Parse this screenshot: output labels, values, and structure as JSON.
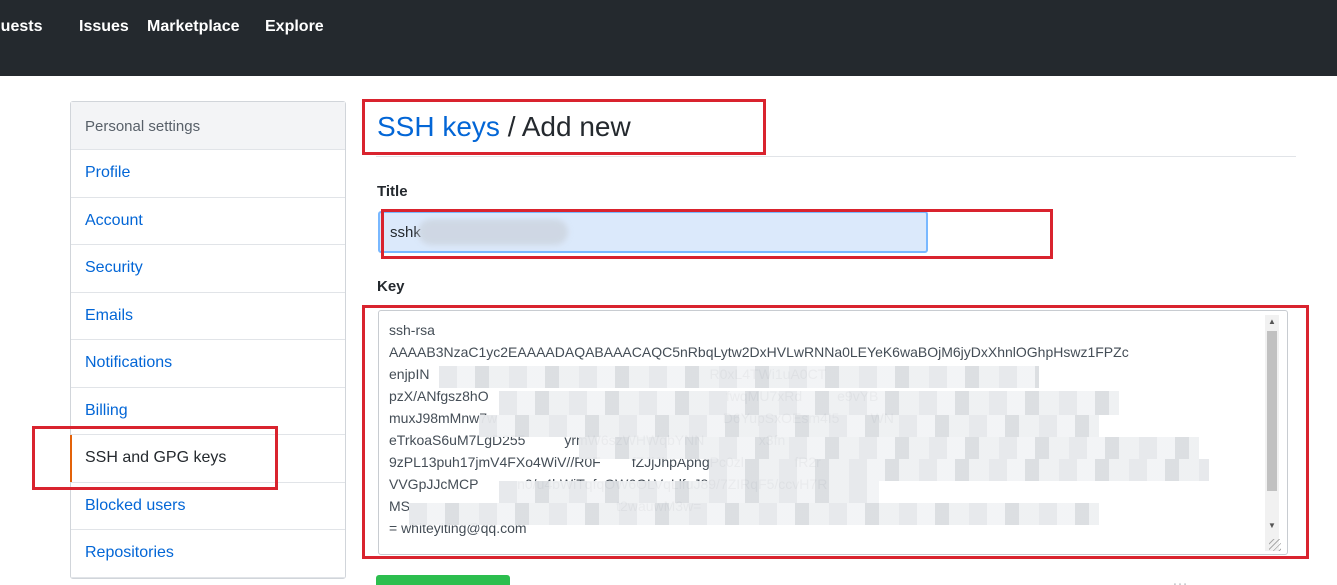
{
  "header": {
    "nav": [
      {
        "label": "equests"
      },
      {
        "label": "Issues"
      },
      {
        "label": "Marketplace"
      },
      {
        "label": "Explore"
      }
    ]
  },
  "sidebar": {
    "title": "Personal settings",
    "items": [
      {
        "label": "Profile"
      },
      {
        "label": "Account"
      },
      {
        "label": "Security"
      },
      {
        "label": "Emails"
      },
      {
        "label": "Notifications"
      },
      {
        "label": "Billing"
      },
      {
        "label": "SSH and GPG keys",
        "selected": true
      },
      {
        "label": "Blocked users"
      },
      {
        "label": "Repositories"
      }
    ]
  },
  "main": {
    "breadcrumb_link": "SSH keys",
    "breadcrumb_separator": " / ",
    "breadcrumb_current": "Add new",
    "title_label": "Title",
    "title_value": "sshk",
    "key_label": "Key",
    "key_value": "ssh-rsa\nAAAAB3NzaC1yc2EAAAADAQABAAACAQC5nRbqLytw2DxHVLwRNNa0LEYeK6waBOjM6jyDxXhnlOGhpHswz1FPZc\nenjpIN                                                                        R0xL4TWi1uA0CT\npzX/ANfgsz8hO                                                             fwqMU7xRd         e9vYB\nmuxJ98mMnw7w                                                          D6YupSxOEsm4I5        WN\neTrkoaS6uM7LgD255          yrmW6szWHWqbYNN              x3fn\n9zPL13puh17jmV4FXo4WiV//R0F        fZJjJhpApngPc0zl             fR2r\nVVGpJJcMCP          n0/u4bWiTqfqOW6OLVqLlfuJ89/7ZIRqF5/ccvH7R\nMS                                                     t2wauwM3w=\n= whiteyiting@qq.com"
  },
  "colors": {
    "header_bg": "#24292e",
    "link": "#0366d6",
    "selected_indicator": "#e36209",
    "annotation": "#d9232e",
    "submit": "#2cbe4e"
  },
  "watermark": "…"
}
